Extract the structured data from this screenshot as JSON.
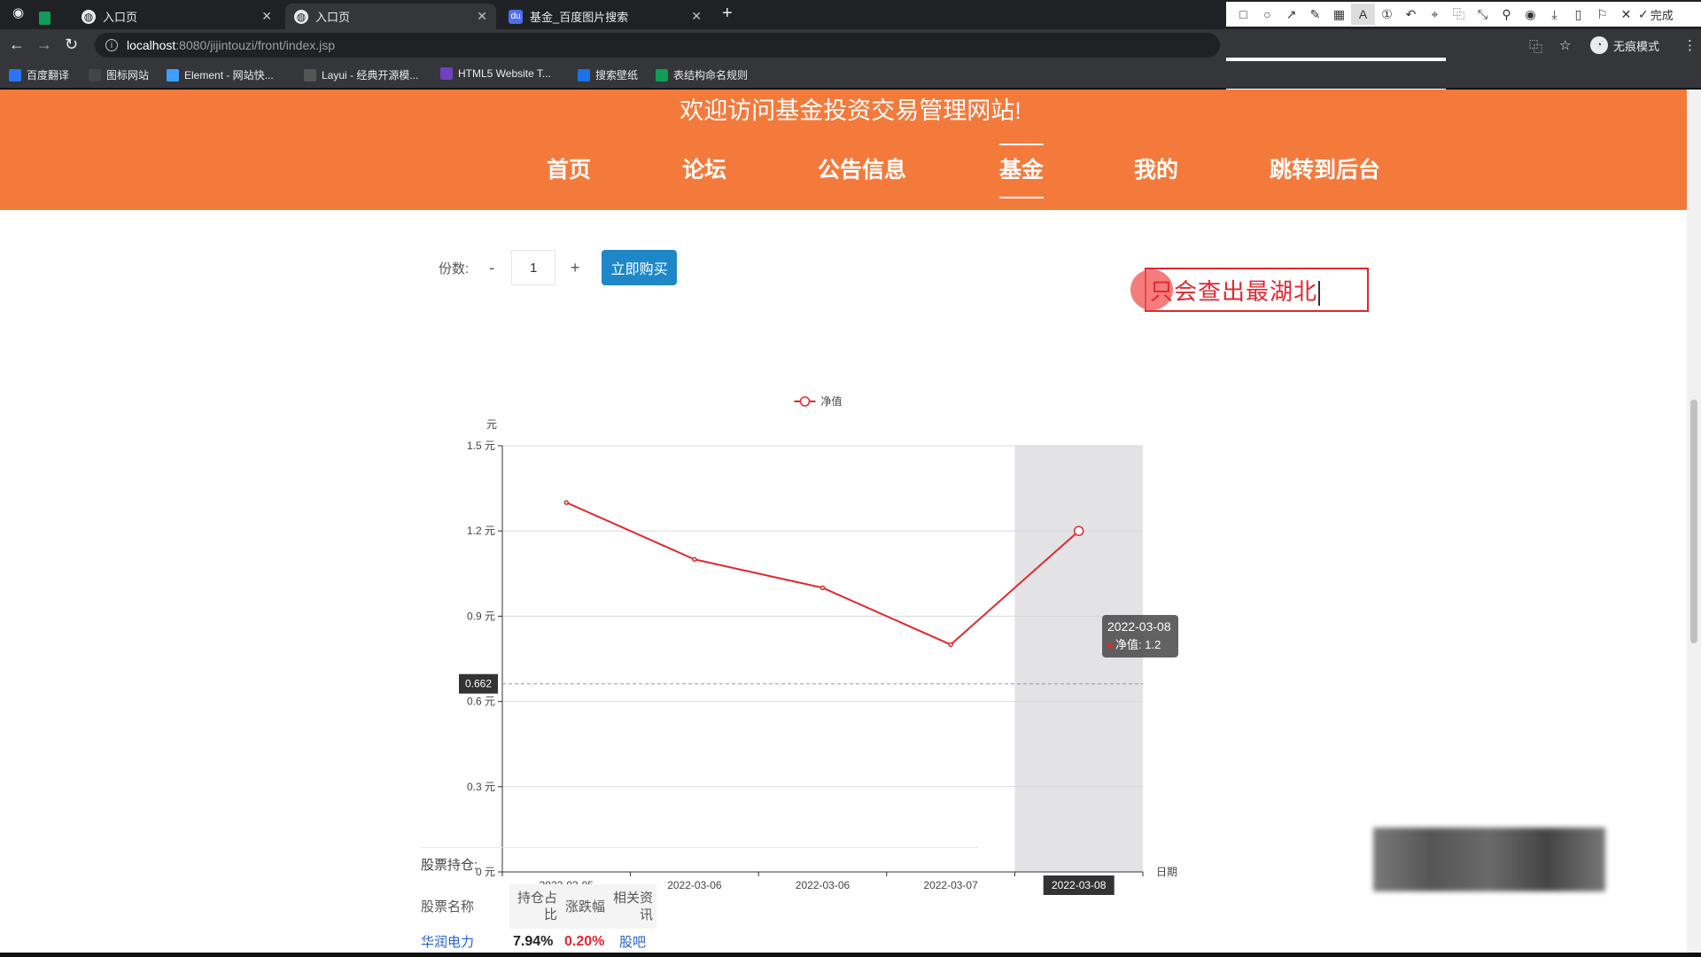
{
  "browser": {
    "tabs": [
      {
        "label": "入口页",
        "icon": "globe-icon"
      },
      {
        "label": "入口页",
        "icon": "globe-icon"
      },
      {
        "label": "基金_百度图片搜索",
        "icon": "baidu-icon"
      }
    ],
    "url_host": "localhost",
    "url_path": ":8080/jijintouzi/front/index.jsp",
    "incognito_label": "无痕模式",
    "bookmarks": [
      {
        "label": "百度翻译",
        "icon": "translate-icon",
        "color": "#2b74f7"
      },
      {
        "label": "图标网站",
        "icon": "flag-icon",
        "color": "#444444"
      },
      {
        "label": "Element - 网站快...",
        "icon": "element-icon",
        "color": "#409eff"
      },
      {
        "label": "Layui - 经典开源模...",
        "icon": "layui-icon",
        "color": "#555555"
      },
      {
        "label": "HTML5 Website T...",
        "icon": "html5-icon",
        "color": "#6f42c1"
      },
      {
        "label": "搜索壁纸",
        "icon": "wallpaper-icon",
        "color": "#1a73e8"
      },
      {
        "label": "表结构命名规则",
        "icon": "sheet-icon",
        "color": "#0f9d58"
      }
    ]
  },
  "snip_tool": {
    "done_label": "完成",
    "font_size": "20",
    "current_color": "#ff3b30"
  },
  "site": {
    "welcome": "欢迎访问基金投资交易管理网站!",
    "nav": [
      "首页",
      "论坛",
      "公告信息",
      "基金",
      "我的",
      "跳转到后台"
    ],
    "active_nav": "基金"
  },
  "purchase": {
    "shares_label": "份数:",
    "minus": "-",
    "plus": "+",
    "quantity": "1",
    "buy_label": "立即购买"
  },
  "annotation": {
    "text": "只会查出最湖北"
  },
  "chart_data": {
    "type": "line",
    "legend": "净值",
    "y_unit_label": "元",
    "x_axis_name": "日期",
    "categories": [
      "2022-03-05",
      "2022-03-06",
      "2022-03-06",
      "2022-03-07",
      "2022-03-08"
    ],
    "series": [
      {
        "name": "净值",
        "values": [
          1.3,
          1.1,
          1.0,
          0.8,
          1.2
        ],
        "color": "#e0282e"
      }
    ],
    "ylim": [
      0,
      1.5
    ],
    "yticks": [
      "0 元",
      "0.3 元",
      "0.6 元",
      "0.9 元",
      "1.2 元",
      "1.5 元"
    ],
    "ytick_values": [
      0,
      0.3,
      0.6,
      0.9,
      1.2,
      1.5
    ],
    "highlight_index": 4,
    "crosshair_value": "0.662",
    "crosshair_y": 0.662,
    "grid": true,
    "legend_position": "top"
  },
  "tooltip": {
    "date": "2022-03-08",
    "label": "净值: 1.2"
  },
  "holdings": {
    "title": "股票持仓:",
    "headers": [
      "股票名称",
      "持仓占比",
      "涨跌幅",
      "相关资讯"
    ],
    "rows": [
      {
        "name": "华润电力",
        "ratio": "7.94%",
        "change": "0.20%",
        "news": "股吧"
      }
    ]
  }
}
